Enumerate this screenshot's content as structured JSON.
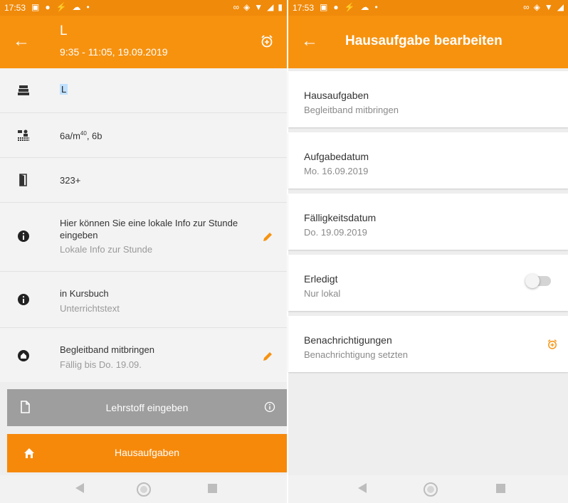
{
  "left": {
    "status": {
      "time": "17:53"
    },
    "header": {
      "title": "L",
      "subtitle": "9:35 - 11:05, 19.09.2019"
    },
    "rows": [
      {
        "icon": "books-icon",
        "text": "L"
      },
      {
        "icon": "class-group-icon",
        "text": "6a/m",
        "sup": "40",
        "text_suffix": ", 6b"
      },
      {
        "icon": "door-icon",
        "text": "323+"
      },
      {
        "icon": "info-icon",
        "text": "Hier können Sie eine lokale Info zur Stunde eingeben",
        "subtext": "Lokale Info zur Stunde"
      },
      {
        "icon": "info-icon",
        "text": "in Kursbuch",
        "subtext": "Unterrichtstext"
      },
      {
        "icon": "home-icon",
        "text": "Begleitband mitbringen",
        "subtext": "Fällig bis Do. 19.09."
      }
    ],
    "buttons": {
      "lehrstoff": "Lehrstoff eingeben",
      "hausaufgaben": "Hausaufgaben"
    }
  },
  "right": {
    "status": {
      "time": "17:53"
    },
    "header": {
      "title": "Hausaufgabe bearbeiten"
    },
    "cards": [
      {
        "label": "Hausaufgaben",
        "value": "Begleitband mitbringen"
      },
      {
        "label": "Aufgabedatum",
        "value": "Mo. 16.09.2019"
      },
      {
        "label": "Fälligkeitsdatum",
        "value": "Do. 19.09.2019"
      },
      {
        "label": "Erledigt",
        "value": "Nur lokal"
      },
      {
        "label": "Benachrichtigungen",
        "value": "Benachrichtigung setzten"
      }
    ],
    "toggle_state": "off"
  },
  "colors": {
    "accent": "#f7920f",
    "status_bar": "#f08a0a",
    "gray_button": "#9e9e9e"
  }
}
